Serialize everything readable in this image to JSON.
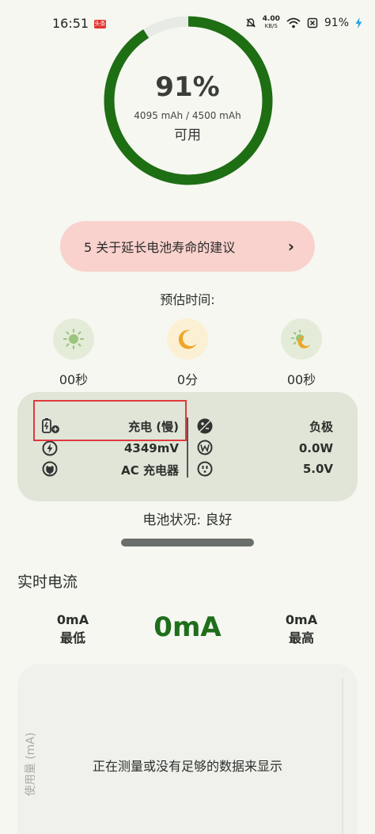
{
  "status_bar": {
    "time": "16:51",
    "badge": "头条",
    "net_speed": "4.00",
    "net_unit": "KB/S",
    "battery_level": "91%"
  },
  "battery": {
    "percent_text": "91%",
    "percent_value": 91,
    "capacity": "4095 mAh / 4500 mAh",
    "status": "可用",
    "ring_color": "#1e6e14",
    "ring_light_color": "#9dc495"
  },
  "tips": {
    "label": "5 关于延长电池寿命的建议",
    "chevron": "›"
  },
  "estimate": {
    "title": "预估时间:",
    "items": [
      {
        "icon": "sun-icon",
        "value": "00秒"
      },
      {
        "icon": "moon-icon",
        "value": "0分"
      },
      {
        "icon": "sun-moon-icon",
        "value": "00秒"
      }
    ]
  },
  "info": {
    "left": [
      {
        "icon": "charging-plug-battery-icon",
        "value": "充电 (慢)"
      },
      {
        "icon": "bolt-icon",
        "value": "4349mV"
      },
      {
        "icon": "ac-plug-icon",
        "value": "AC 充电器"
      }
    ],
    "right": [
      {
        "icon": "polarity-icon",
        "value": "负极"
      },
      {
        "icon": "watt-icon",
        "value": "0.0W"
      },
      {
        "icon": "outlet-icon",
        "value": "5.0V"
      }
    ]
  },
  "health": "电池状况: 良好",
  "realtime": {
    "title": "实时电流",
    "min_value": "0mA",
    "min_label": "最低",
    "current": "0mA",
    "max_value": "0mA",
    "max_label": "最高"
  },
  "chart": {
    "ylabel": "使用量 (mA)",
    "empty_message": "正在测量或没有足够的数据来显示"
  }
}
